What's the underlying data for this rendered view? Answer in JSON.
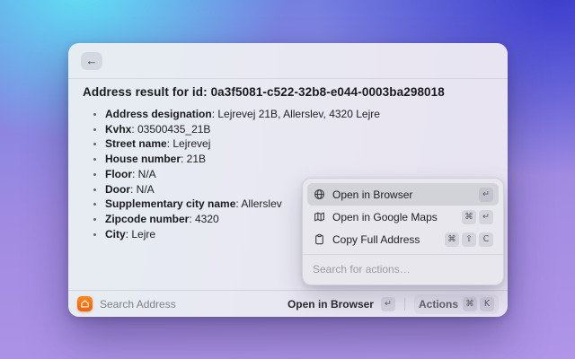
{
  "colors": {
    "accent_orange": "#f3610b",
    "bg_cyan": "#60e2f5",
    "bg_indigo": "#3c3ccd",
    "bg_purple": "#b095e8"
  },
  "window": {
    "back_label": "←"
  },
  "detail": {
    "title": "Address result for id: 0a3f5081-c522-32b8-e044-0003ba298018",
    "fields": [
      {
        "label": "Address designation",
        "value": "Lejrevej 21B, Allerslev, 4320 Lejre"
      },
      {
        "label": "Kvhx",
        "value": "03500435_21B"
      },
      {
        "label": "Street name",
        "value": "Lejrevej"
      },
      {
        "label": "House number",
        "value": "21B"
      },
      {
        "label": "Floor",
        "value": "N/A"
      },
      {
        "label": "Door",
        "value": "N/A"
      },
      {
        "label": "Supplementary city name",
        "value": "Allerslev"
      },
      {
        "label": "Zipcode number",
        "value": "4320"
      },
      {
        "label": "City",
        "value": "Lejre"
      }
    ]
  },
  "actions_menu": {
    "items": [
      {
        "label": "Open in Browser",
        "icon": "globe-icon",
        "keys": [
          "↵"
        ],
        "selected": true
      },
      {
        "label": "Open in Google Maps",
        "icon": "map-icon",
        "keys": [
          "⌘",
          "↵"
        ],
        "selected": false
      },
      {
        "label": "Copy Full Address",
        "icon": "clipboard-icon",
        "keys": [
          "⌘",
          "⇧",
          "C"
        ],
        "selected": false
      }
    ],
    "search_placeholder": "Search for actions…"
  },
  "status_bar": {
    "app_icon": "home-icon",
    "app_name": "Search Address",
    "primary_action": "Open in Browser",
    "primary_keys": [
      "↵"
    ],
    "actions_label": "Actions",
    "actions_keys": [
      "⌘",
      "K"
    ]
  }
}
